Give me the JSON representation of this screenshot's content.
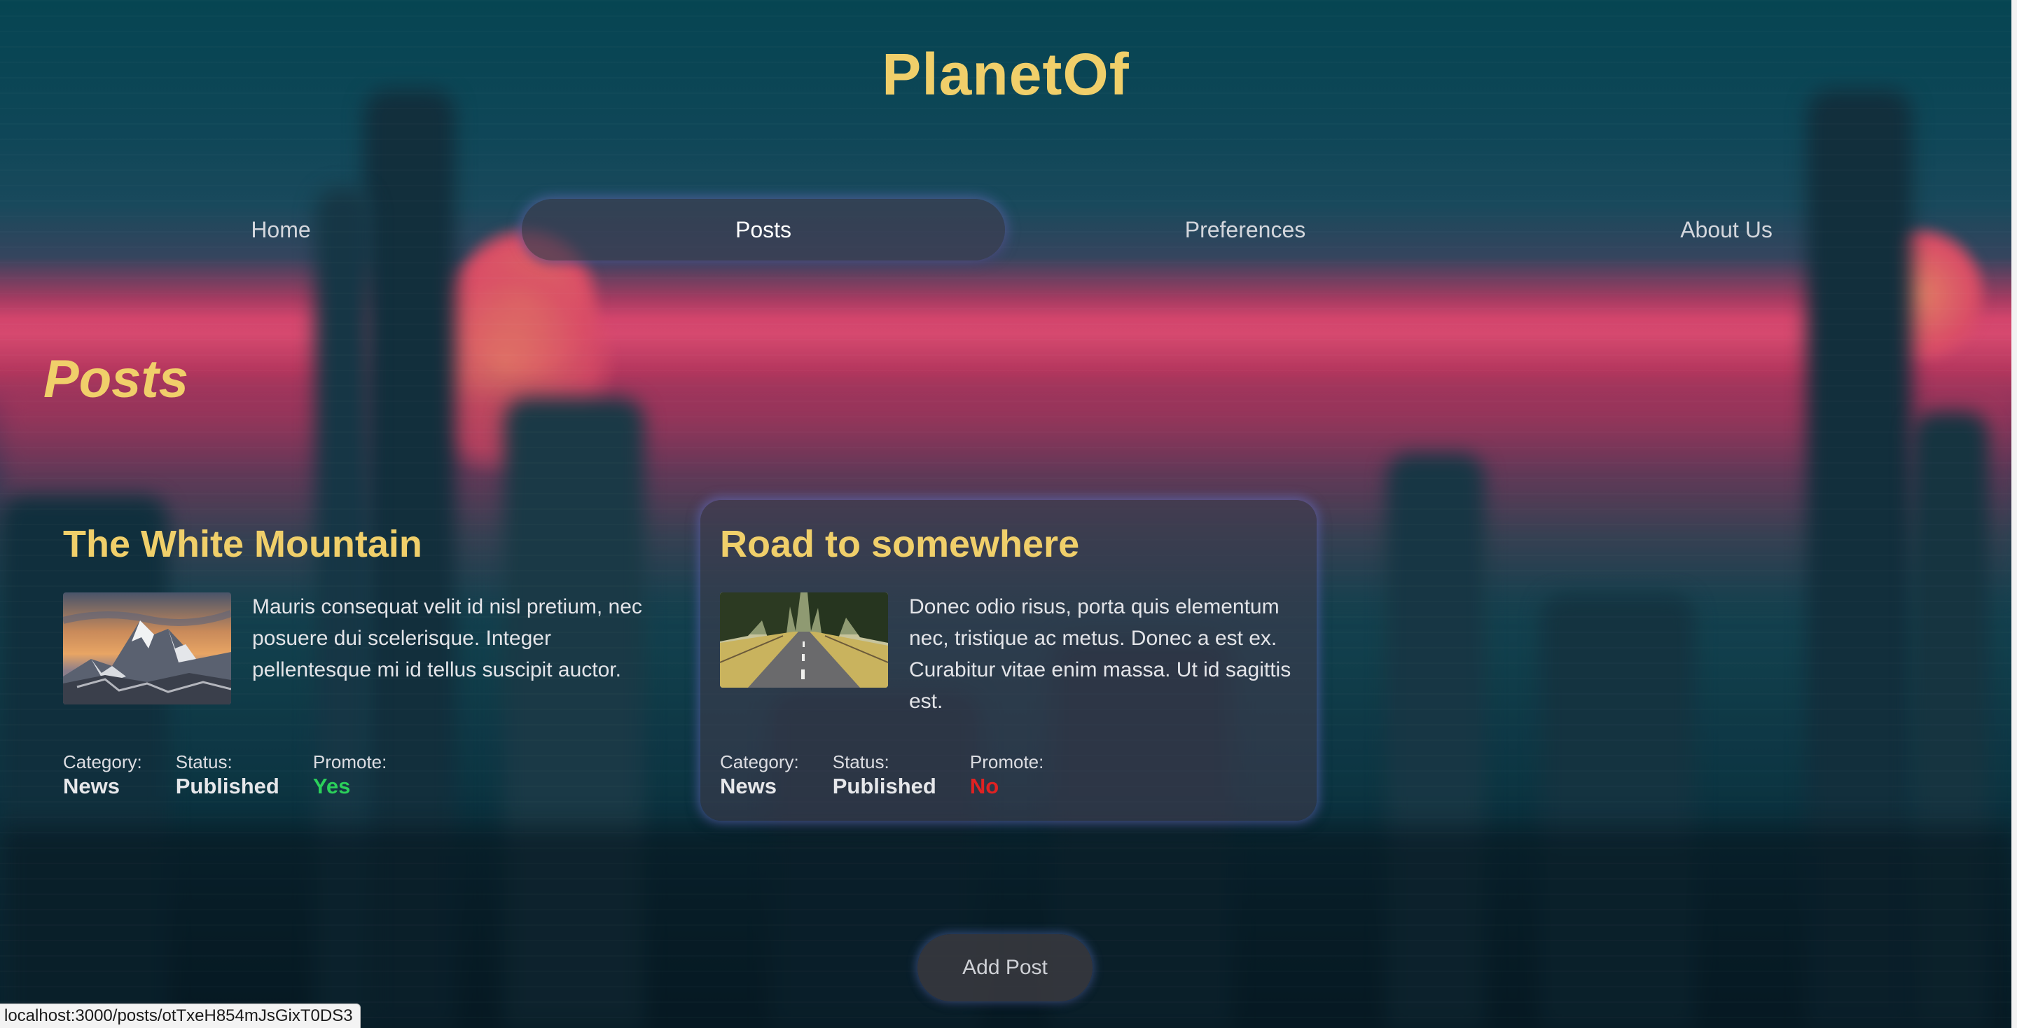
{
  "site": {
    "title": "PlanetOf"
  },
  "nav": {
    "items": [
      {
        "label": "Home",
        "active": false
      },
      {
        "label": "Posts",
        "active": true
      },
      {
        "label": "Preferences",
        "active": false
      },
      {
        "label": "About Us",
        "active": false
      }
    ]
  },
  "page": {
    "heading": "Posts"
  },
  "posts": [
    {
      "title": "The White Mountain",
      "image": "mountain-photo",
      "excerpt": "Mauris consequat velit id nisl pretium, nec posuere dui scelerisque. Integer pellentesque mi id tellus suscipit auctor.",
      "category_label": "Category:",
      "category": "News",
      "status_label": "Status:",
      "status": "Published",
      "promote_label": "Promote:",
      "promote": "Yes",
      "highlighted": false
    },
    {
      "title": "Road to somewhere",
      "image": "road-photo",
      "excerpt": "Donec odio risus, porta quis elementum nec, tristique ac metus. Donec a est ex. Curabitur vitae enim massa. Ut id sagittis est.",
      "category_label": "Category:",
      "category": "News",
      "status_label": "Status:",
      "status": "Published",
      "promote_label": "Promote:",
      "promote": "No",
      "highlighted": true
    }
  ],
  "actions": {
    "add_post_label": "Add Post"
  },
  "status_bar": {
    "url": "localhost:3000/posts/otTxeH854mJsGixT0DS3"
  },
  "colors": {
    "accent": "#f0cf6a",
    "promote_yes": "#2bd05a",
    "promote_no": "#e02222",
    "glow": "#7c82e6"
  }
}
